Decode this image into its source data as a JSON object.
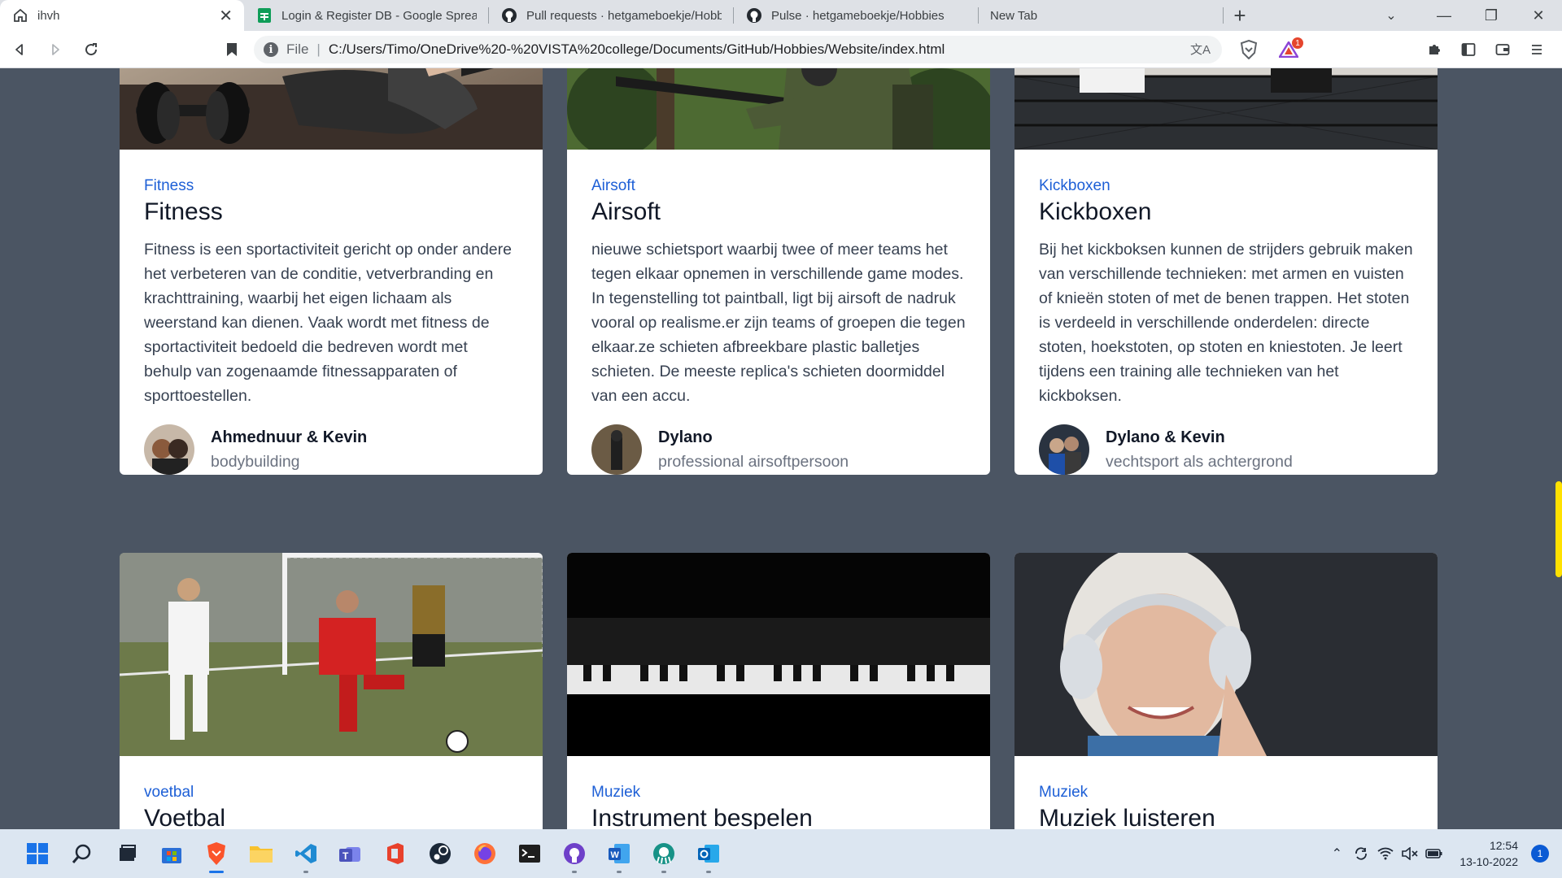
{
  "browser": {
    "tabs": [
      {
        "title": "ihvh",
        "icon": "home-icon",
        "active": true
      },
      {
        "title": "Login & Register DB - Google Spreads",
        "icon": "google-sheets-icon"
      },
      {
        "title": "Pull requests · hetgameboekje/Hobbie",
        "icon": "github-icon"
      },
      {
        "title": "Pulse · hetgameboekje/Hobbies",
        "icon": "github-icon"
      },
      {
        "title": "New Tab",
        "icon": ""
      }
    ],
    "address": {
      "scheme": "File",
      "url": "C:/Users/Timo/OneDrive%20-%20VISTA%20college/Documents/GitHub/Hobbies/Website/index.html"
    },
    "rewards_badge": "1"
  },
  "cards": [
    {
      "category": "Fitness",
      "title": "Fitness",
      "description": "Fitness is een sportactiviteit gericht op onder andere het verbeteren van de conditie, vetverbranding en krachttraining, waarbij het eigen lichaam als weerstand kan dienen. Vaak wordt met fitness de sportactiviteit bedoeld die bedreven wordt met behulp van zogenaamde fitnessapparaten of sporttoestellen.",
      "author_name": "Ahmednuur & Kevin",
      "author_role": "bodybuilding"
    },
    {
      "category": "Airsoft",
      "title": "Airsoft",
      "description": "nieuwe schietsport waarbij twee of meer teams het tegen elkaar opnemen in verschillende game modes. In tegenstelling tot paintball, ligt bij airsoft de nadruk vooral op realisme.er zijn teams of groepen die tegen elkaar.ze schieten afbreekbare plastic balletjes schieten. De meeste replica's schieten doormiddel van een accu.",
      "author_name": "Dylano",
      "author_role": "professional airsoftpersoon"
    },
    {
      "category": "Kickboxen",
      "title": "Kickboxen",
      "description": "Bij het kickboksen kunnen de strijders gebruik maken van verschillende technieken: met armen en vuisten of knieën stoten of met de benen trappen. Het stoten is verdeeld in verschillende onderdelen: directe stoten, hoekstoten, op stoten en kniestoten. Je leert tijdens een training alle technieken van het kickboksen.",
      "author_name": "Dylano & Kevin",
      "author_role": "vechtsport als achtergrond"
    },
    {
      "category": "voetbal",
      "title": "Voetbal"
    },
    {
      "category": "Muziek",
      "title": "Instrument bespelen"
    },
    {
      "category": "Muziek",
      "title": "Muziek luisteren"
    }
  ],
  "taskbar": {
    "apps": [
      "start-icon",
      "search-icon",
      "task-view-icon",
      "microsoft-store-icon",
      "brave-icon",
      "file-explorer-icon",
      "vscode-icon",
      "teams-icon",
      "office-icon",
      "steam-icon",
      "firefox-icon",
      "terminal-icon",
      "github-desktop-icon",
      "word-icon",
      "gitkraken-icon",
      "outlook-icon"
    ],
    "time": "12:54",
    "date": "13-10-2022",
    "notifications": "1"
  }
}
